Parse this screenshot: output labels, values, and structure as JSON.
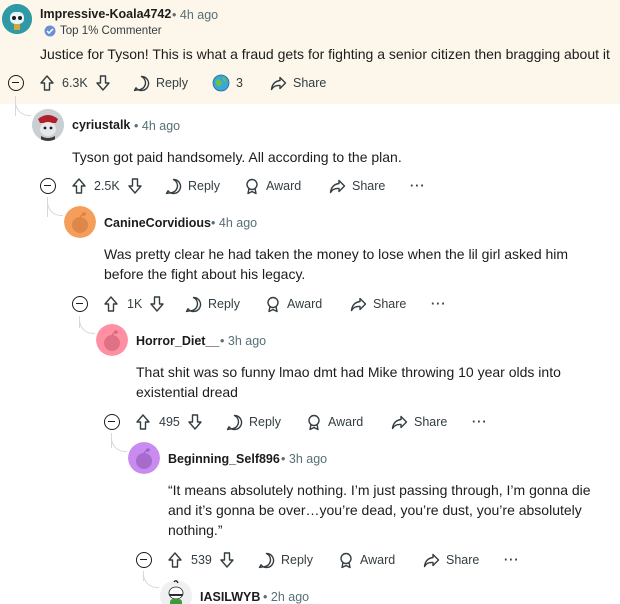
{
  "comments": [
    {
      "username": "Impressive-Koala4742",
      "time": "4h ago",
      "flair": "Top 1% Commenter",
      "text": "Justice for Tyson! This is what a fraud gets for fighting a senior citizen then bragging about it",
      "votes": "6.3K",
      "reply_label": "Reply",
      "award_count": "3",
      "share_label": "Share"
    },
    {
      "username": "cyriustalk",
      "time": "4h ago",
      "text": "Tyson got paid handsomely. All according to the plan.",
      "votes": "2.5K",
      "reply_label": "Reply",
      "award_label": "Award",
      "share_label": "Share"
    },
    {
      "username": "CanineCorvidious",
      "time": "4h ago",
      "text_line1": "Was pretty clear he had taken the money to lose when the lil girl asked him",
      "text_line2": "before the fight about his legacy.",
      "votes": "1K",
      "reply_label": "Reply",
      "award_label": "Award",
      "share_label": "Share"
    },
    {
      "username": "Horror_Diet__",
      "time": "3h ago",
      "text_line1": "That shit was so funny lmao dmt had Mike throwing 10 year olds into",
      "text_line2": "existential dread",
      "votes": "495",
      "reply_label": "Reply",
      "award_label": "Award",
      "share_label": "Share"
    },
    {
      "username": "Beginning_Self896",
      "time": "3h ago",
      "text_line1": "“It means absolutely nothing. I’m just passing through, I’m gonna die",
      "text_line2": "and it’s gonna be over…you’re dead, you’re dust, you’re absolutely",
      "text_line3": "nothing.”",
      "votes": "539",
      "reply_label": "Reply",
      "award_label": "Award",
      "share_label": "Share"
    },
    {
      "username": "IASILWYB",
      "time": "2h ago"
    }
  ],
  "separator": "•",
  "more_glyph": "···",
  "colors": {
    "highlight_bg": "#fcf7ea",
    "thread_line": "#d3d9dc",
    "meta_text": "#576f76",
    "avatar_orange": "#f59e5c",
    "avatar_pink": "#ff8fa3",
    "avatar_purple": "#c98bf0"
  }
}
